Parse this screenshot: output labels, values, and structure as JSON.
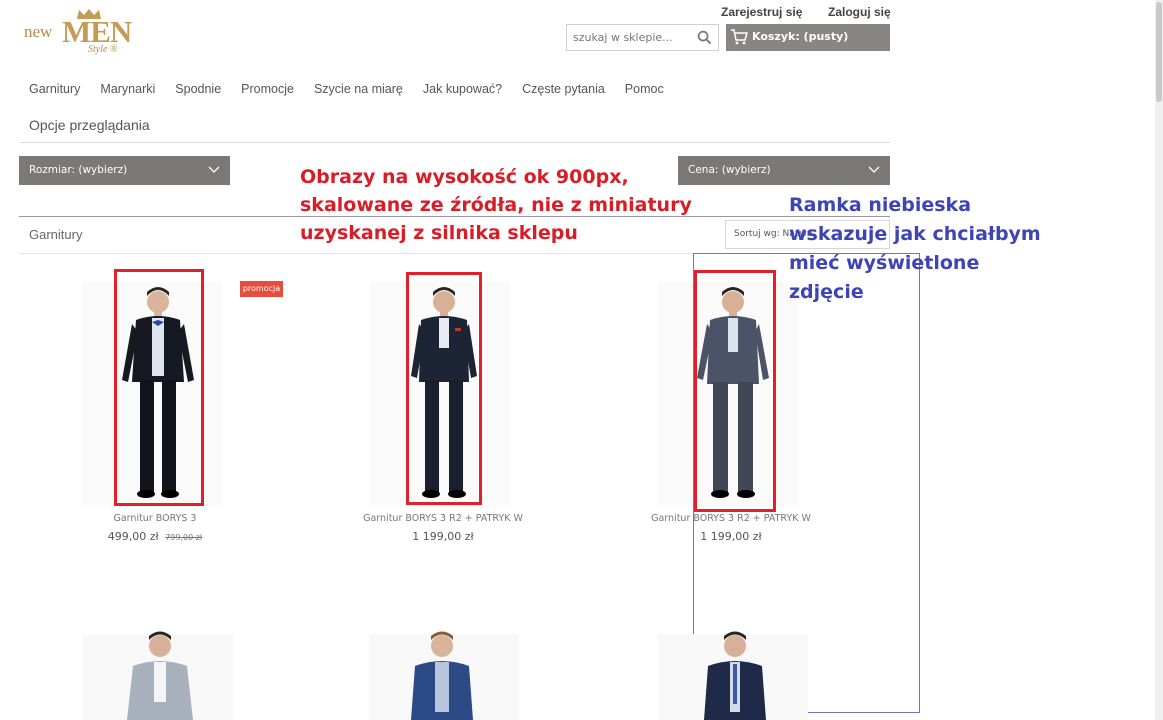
{
  "header": {
    "logo_prefix": "new",
    "logo_main": "MEN",
    "logo_suffix": "Style ®",
    "register_link": "Zarejestruj się",
    "login_link": "Zaloguj się",
    "search_placeholder": "szukaj w sklepie...",
    "cart_label": "Koszyk: (pusty)"
  },
  "nav": {
    "items": [
      "Garnitury",
      "Marynarki",
      "Spodnie",
      "Promocje",
      "Szycie na miarę",
      "Jak kupować?",
      "Częste pytania",
      "Pomoc"
    ],
    "options_label": "Opcje przeglądania"
  },
  "filters": {
    "size_label": "Rozmiar: (wybierz)",
    "price_label": "Cena: (wybierz)"
  },
  "category": {
    "title": "Garnitury",
    "sort_label": "Sortuj wg: Nazwa"
  },
  "products": [
    {
      "name": "Garnitur BORYS 3",
      "price": "499,00 zł",
      "old_price": "799,00 zł",
      "badge": "promocja"
    },
    {
      "name": "Garnitur BORYS 3 R2 + PATRYK W",
      "price": "1 199,00 zł",
      "old_price": ""
    },
    {
      "name": "Garnitur BORYS 3 R2 + PATRYK W",
      "price": "1 199,00 zł",
      "old_price": ""
    }
  ],
  "annotations": {
    "red_lines": [
      "Obrazy na wysokość ok 900px,",
      "skalowane ze źródła, nie z miniatury",
      "uzyskanej z silnika sklepu"
    ],
    "blue_lines": [
      "Ramka niebieska",
      "wskazuje jak chciałbym",
      "mieć wyświetlone",
      "zdjęcie"
    ],
    "red_color": "#d91d27",
    "blue_color": "#3c44b6"
  },
  "colors": {
    "filter_bg": "#7d7878",
    "cart_bg": "#8a8585",
    "badge_bg": "#e74c3c",
    "logo_gold": "#c49a57"
  }
}
